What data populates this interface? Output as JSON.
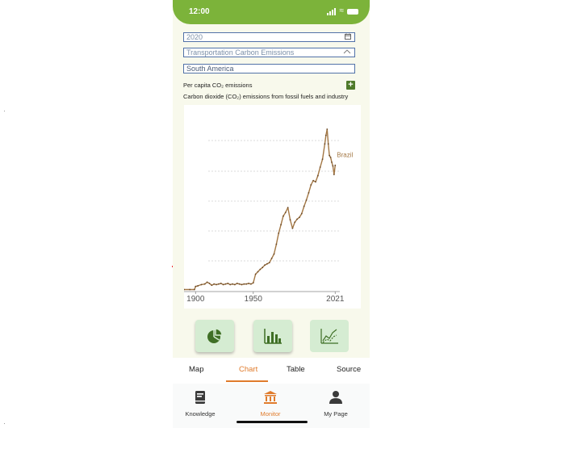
{
  "status": {
    "time": "12:00"
  },
  "filters": {
    "year": "2020",
    "dataset": "Transportation Carbon Emissions",
    "region": "South America"
  },
  "labels": {
    "per_capita": "Per capita CO₂ emissions",
    "add_button": "+",
    "chart_subtitle": "Carbon dioxide (CO₂) emissions from fossil fuels and industry"
  },
  "chart_data": {
    "type": "line",
    "xlim": [
      1890,
      2025
    ],
    "x_ticks": [
      1900,
      1950,
      2021
    ],
    "x_tick_labels": [
      "1900",
      "1950",
      "2021"
    ],
    "grid": "horizontal",
    "series": [
      {
        "name": "Brazil",
        "color": "#a37744",
        "x": [
          1890,
          1895,
          1899,
          1900,
          1902,
          1905,
          1908,
          1910,
          1912,
          1914,
          1916,
          1918,
          1920,
          1922,
          1924,
          1926,
          1928,
          1930,
          1932,
          1934,
          1936,
          1938,
          1940,
          1942,
          1944,
          1946,
          1948,
          1950,
          1952,
          1954,
          1956,
          1958,
          1960,
          1962,
          1964,
          1966,
          1968,
          1970,
          1972,
          1974,
          1976,
          1978,
          1980,
          1982,
          1984,
          1986,
          1988,
          1990,
          1992,
          1994,
          1996,
          1998,
          2000,
          2002,
          2004,
          2006,
          2008,
          2010,
          2012,
          2013,
          2014,
          2015,
          2016,
          2017,
          2018,
          2019,
          2020,
          2021
        ],
        "y": [
          0.02,
          0.02,
          0.02,
          0.07,
          0.08,
          0.1,
          0.11,
          0.14,
          0.12,
          0.09,
          0.11,
          0.1,
          0.11,
          0.12,
          0.1,
          0.11,
          0.12,
          0.1,
          0.11,
          0.1,
          0.12,
          0.11,
          0.1,
          0.11,
          0.11,
          0.12,
          0.11,
          0.13,
          0.27,
          0.31,
          0.35,
          0.38,
          0.42,
          0.44,
          0.46,
          0.53,
          0.6,
          0.76,
          0.94,
          1.08,
          1.22,
          1.28,
          1.36,
          1.16,
          1.02,
          1.12,
          1.17,
          1.2,
          1.26,
          1.38,
          1.48,
          1.6,
          1.73,
          1.8,
          1.78,
          1.88,
          2.02,
          2.15,
          2.4,
          2.54,
          2.64,
          2.4,
          2.21,
          2.18,
          2.1,
          2.04,
          1.9,
          2.05
        ]
      }
    ]
  },
  "tools": {
    "pie": "pie-chart-icon",
    "bar": "bar-chart-icon",
    "line": "line-chart-icon"
  },
  "tabs": [
    {
      "label": "Map"
    },
    {
      "label": "Chart"
    },
    {
      "label": "Table"
    },
    {
      "label": "Source"
    }
  ],
  "nav": [
    {
      "label": "Knowledge",
      "icon": "book-icon"
    },
    {
      "label": "Monitor",
      "icon": "bank-icon"
    },
    {
      "label": "My Page",
      "icon": "user-icon"
    }
  ],
  "colors": {
    "accent_green": "#7cb33a",
    "accent_orange": "#e07b2c",
    "line_color": "#a37744"
  }
}
